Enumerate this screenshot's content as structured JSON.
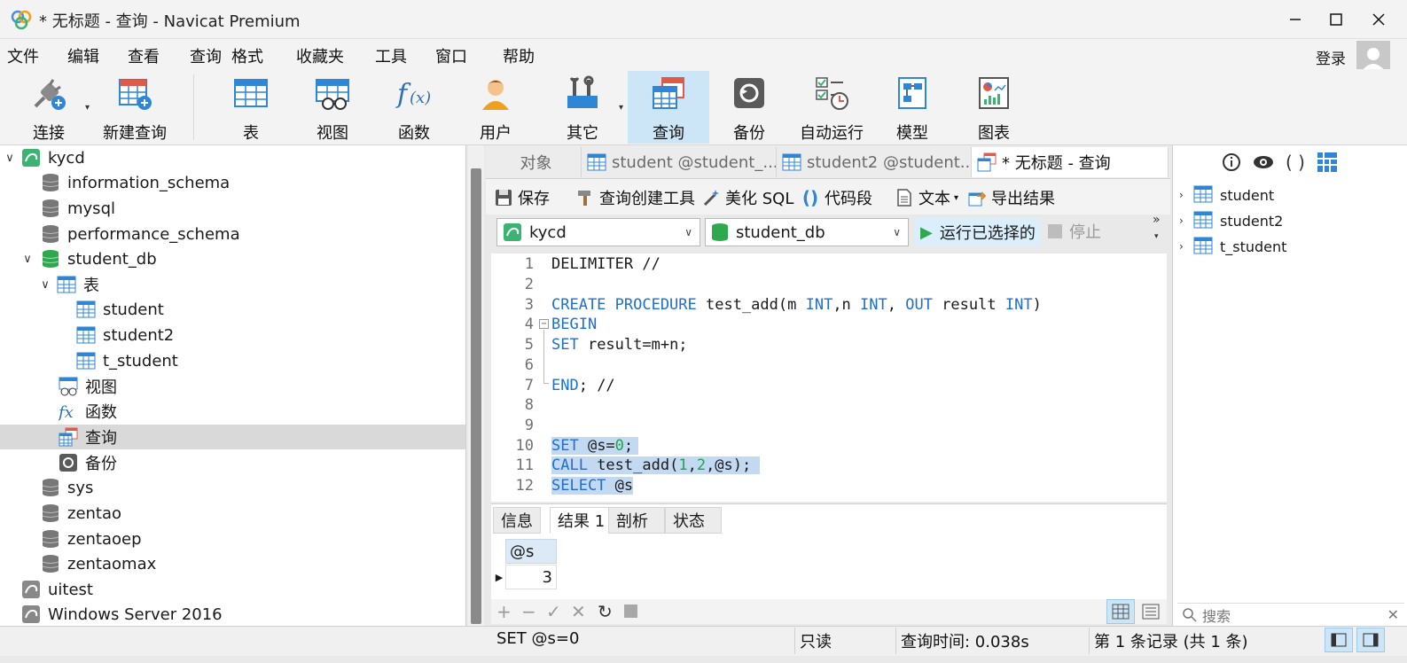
{
  "window": {
    "title": "* 无标题 - 查询 - Navicat Premium"
  },
  "menu": {
    "items": [
      "文件",
      "编辑",
      "查看",
      "查询",
      "格式",
      "收藏夹",
      "工具",
      "窗口",
      "帮助"
    ],
    "login": "登录"
  },
  "toolbar": {
    "connect": "连接",
    "new_query": "新建查询",
    "table": "表",
    "view": "视图",
    "function": "函数",
    "user": "用户",
    "other": "其它",
    "query": "查询",
    "backup": "备份",
    "auto_run": "自动运行",
    "model": "模型",
    "chart": "图表"
  },
  "tree": {
    "connection": "kycd",
    "databases": [
      "information_schema",
      "mysql",
      "performance_schema"
    ],
    "student_db": "student_db",
    "tables_group": "表",
    "tables": [
      "student",
      "student2",
      "t_student"
    ],
    "views": "视图",
    "functions": "函数",
    "queries": "查询",
    "backups": "备份",
    "other_dbs": [
      "sys",
      "zentao",
      "zentaoep",
      "zentaomax"
    ],
    "uitest": "uitest",
    "windows_server": "Windows Server 2016"
  },
  "tabs": {
    "objects": "对象",
    "tab1": "student @student_...",
    "tab2": "student2 @student...",
    "tab3": "* 无标题 - 查询"
  },
  "query_toolbar": {
    "save": "保存",
    "builder": "查询创建工具",
    "beautify": "美化 SQL",
    "snippet": "代码段",
    "text": "文本",
    "export": "导出结果"
  },
  "selectors": {
    "connection": "kycd",
    "database": "student_db",
    "run_selected": "运行已选择的",
    "stop": "停止"
  },
  "editor": {
    "line_numbers": [
      "1",
      "2",
      "3",
      "4",
      "5",
      "6",
      "7",
      "8",
      "9",
      "10",
      "11",
      "12"
    ],
    "l1": "DELIMITER //",
    "l3_kw1": "CREATE PROCEDURE",
    "l3_a": " test_add(m ",
    "l3_int1": "INT",
    "l3_b": ",n ",
    "l3_int2": "INT",
    "l3_c": ", ",
    "l3_out": "OUT",
    "l3_d": " result ",
    "l3_int3": "INT",
    "l3_e": ")",
    "l4": "BEGIN",
    "l5_kw": "SET",
    "l5_rest": " result=m+n;",
    "l7_kw": "END",
    "l7_rest": "; //",
    "l10_kw": "SET",
    "l10_a": " @s=",
    "l10_num": "0",
    "l10_b": ";",
    "l11_kw": "CALL",
    "l11_a": " test_add(",
    "l11_n1": "1",
    "l11_b": ",",
    "l11_n2": "2",
    "l11_c": ",@s);",
    "l12_kw": "SELECT",
    "l12_rest": " @s"
  },
  "result": {
    "tabs": [
      "信息",
      "结果 1",
      "剖析",
      "状态"
    ],
    "column": "@s",
    "value": "3"
  },
  "right_panel": {
    "tables": [
      "student",
      "student2",
      "t_student"
    ],
    "search_placeholder": "搜索"
  },
  "status": {
    "sql": "SET @s=0",
    "readonly": "只读",
    "query_time": "查询时间: 0.038s",
    "records": "第 1 条记录 (共 1 条)"
  }
}
